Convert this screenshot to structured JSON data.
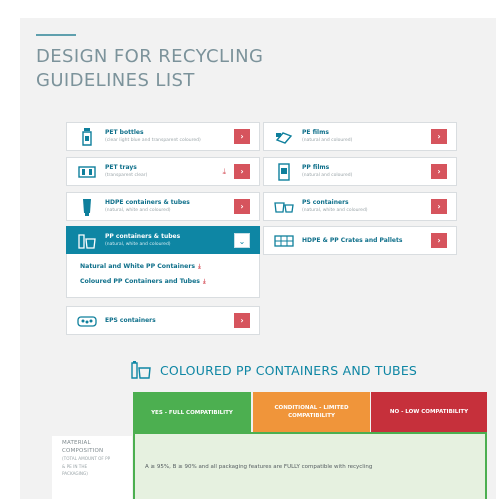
{
  "heading": {
    "title_line1": "DESIGN FOR RECYCLING",
    "title_line2": "GUIDELINES LIST"
  },
  "cards": [
    {
      "name": "PET bottles",
      "sub": "(clear light blue and transparent coloured)",
      "icon": "bottle-icon"
    },
    {
      "name": "PE films",
      "sub": "(natural and coloured)",
      "icon": "film-icon"
    },
    {
      "name": "PET trays",
      "sub": "(transparent clear)",
      "icon": "tray-icon"
    },
    {
      "name": "PP films",
      "sub": "(natural and coloured)",
      "icon": "film-pack-icon"
    },
    {
      "name": "HDPE containers & tubes",
      "sub": "(natural, white and coloured)",
      "icon": "tube-icon"
    },
    {
      "name": "PS containers",
      "sub": "(natural, white and coloured)",
      "icon": "cup-icon"
    },
    {
      "name": "PP containers & tubes",
      "sub": "(natural, white and coloured)",
      "icon": "containers-icon"
    },
    {
      "name": "HDPE & PP Crates and Pallets",
      "sub": "",
      "icon": "crate-icon"
    },
    {
      "name": "EPS containers",
      "sub": "",
      "icon": "eps-icon"
    }
  ],
  "arrow_glyph": "›",
  "chevron_glyph": "⌄",
  "download_glyph": "⤓",
  "expanded_links": [
    {
      "label": "Natural and White PP Containers"
    },
    {
      "label": "Coloured PP Containers and Tubes"
    }
  ],
  "section": {
    "title": "COLOURED PP CONTAINERS AND TUBES"
  },
  "tabs": {
    "full": "YES - FULL COMPATIBILITY",
    "limited": "CONDITIONAL - LIMITED COMPATIBILITY",
    "low": "NO - LOW COMPATIBILITY"
  },
  "material": {
    "label1": "MATERIAL",
    "label2": "COMPOSITION",
    "note1": "(TOTAL AMOUNT OF PP",
    "note2": "& PE IN THE",
    "note3": "PACKAGING)"
  },
  "panel_text": "A ≥ 95%, B ≥ 90% and all packaging features are FULLY compatible with recycling",
  "colors": {
    "accent_teal": "#0e86a4",
    "arrow_red": "#d6545d",
    "full_green": "#4caf50",
    "limited_orange": "#f0953a",
    "low_red": "#c6303b"
  }
}
